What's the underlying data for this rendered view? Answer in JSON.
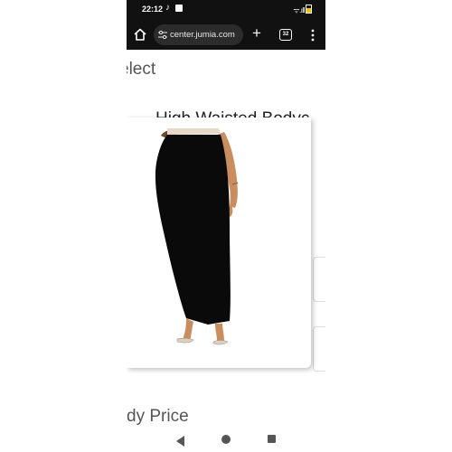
{
  "status_bar": {
    "time": "22:12",
    "tiktok_glyph": "♪",
    "signal_text": "ᯤ.ıll"
  },
  "browser": {
    "url": "center.jumia.com",
    "new_tab_symbol": "+",
    "tab_count": "32"
  },
  "page": {
    "select_heading": "elect",
    "product_title": "High Waisted Bodyc",
    "price_heading": "dy Price"
  },
  "colors": {
    "status_bar_bg": "#111111",
    "url_pill_bg": "#2c2c2c",
    "skirt": "#0a0a0a",
    "skin": "#c98d60"
  },
  "icons": [
    "home-icon",
    "tune-icon",
    "plus-icon",
    "tab-switcher-icon",
    "more-vert-icon",
    "back-icon",
    "home-circle-icon",
    "recents-icon"
  ]
}
